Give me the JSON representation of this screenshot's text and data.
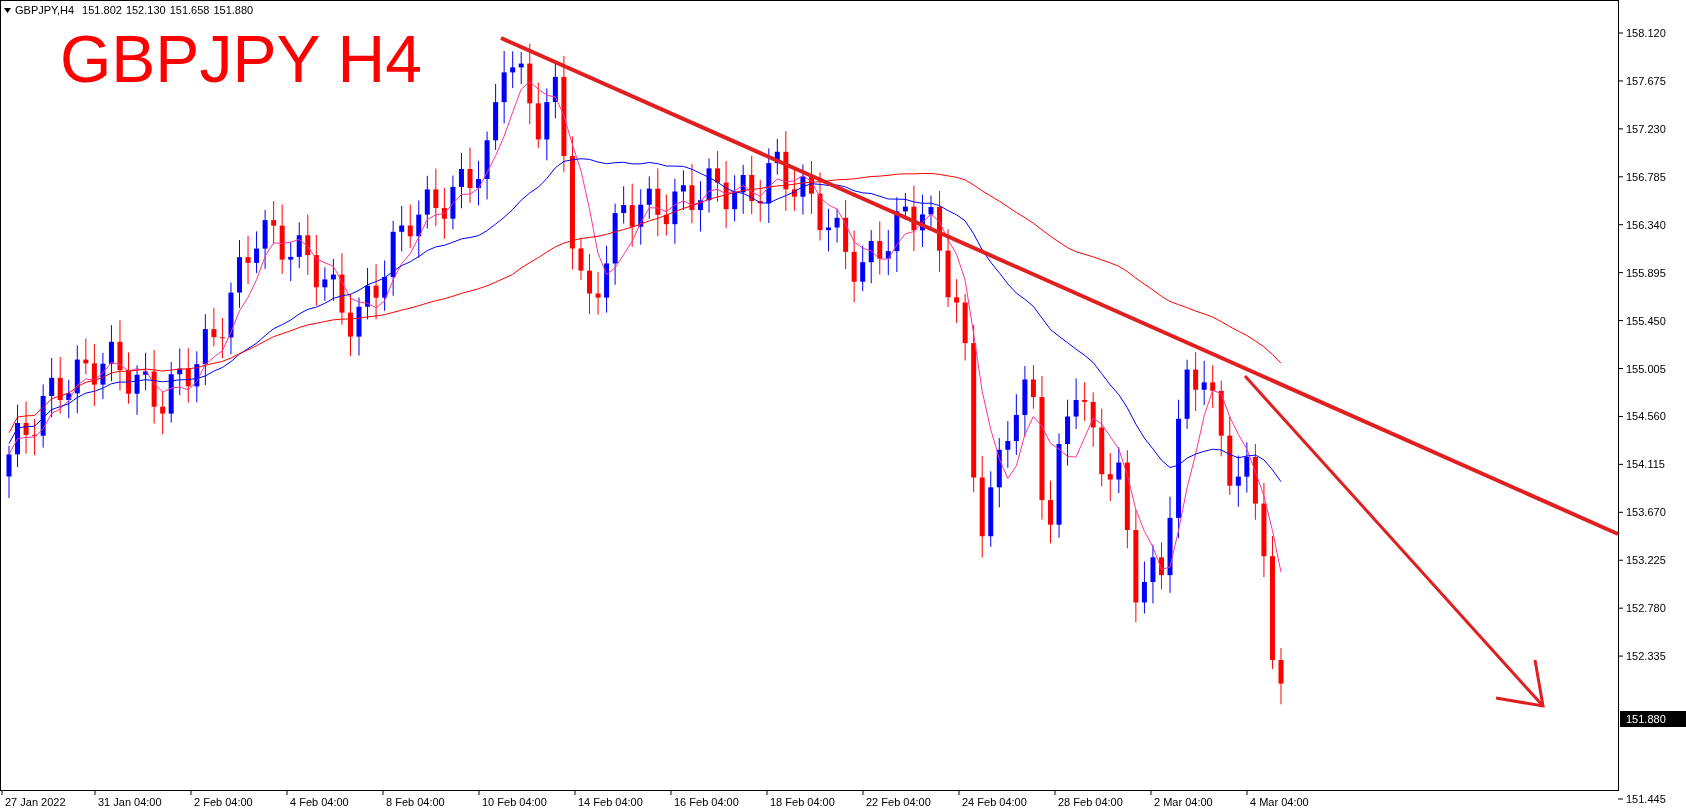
{
  "header": {
    "symbol": "GBPJPY,H4",
    "open": "151.802",
    "high": "152.130",
    "low": "151.658",
    "close": "151.880"
  },
  "title": "GBPJPY H4",
  "price_axis": {
    "ticks": [
      "158.120",
      "157.675",
      "157.230",
      "156.785",
      "156.340",
      "155.895",
      "155.450",
      "155.005",
      "154.560",
      "154.115",
      "153.670",
      "153.225",
      "152.780",
      "152.335",
      "151.445"
    ],
    "current_price": "151.880"
  },
  "time_axis": {
    "labels": [
      "27 Jan 2022",
      "31 Jan 04:00",
      "2 Feb 04:00",
      "4 Feb 04:00",
      "8 Feb 04:00",
      "10 Feb 04:00",
      "14 Feb 04:00",
      "16 Feb 04:00",
      "18 Feb 04:00",
      "22 Feb 04:00",
      "24 Feb 04:00",
      "28 Feb 04:00",
      "2 Mar 04:00",
      "4 Mar 04:00"
    ]
  }
}
